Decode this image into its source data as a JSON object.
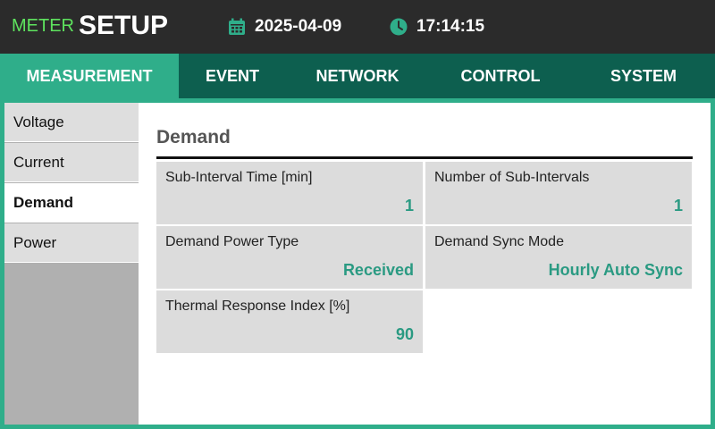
{
  "header": {
    "brand_primary": "METER",
    "brand_secondary": "SETUP",
    "date": "2025-04-09",
    "time": "17:14:15",
    "date_icon": "calendar-icon",
    "time_icon": "clock-icon"
  },
  "tabs": [
    {
      "label": "MEASUREMENT",
      "active": true
    },
    {
      "label": "EVENT",
      "active": false
    },
    {
      "label": "NETWORK",
      "active": false
    },
    {
      "label": "CONTROL",
      "active": false
    },
    {
      "label": "SYSTEM",
      "active": false
    }
  ],
  "sidebar": {
    "items": [
      {
        "label": "Voltage",
        "active": false
      },
      {
        "label": "Current",
        "active": false
      },
      {
        "label": "Demand",
        "active": true
      },
      {
        "label": "Power",
        "active": false
      }
    ]
  },
  "main": {
    "title": "Demand",
    "fields": [
      {
        "label": "Sub-Interval Time [min]",
        "value": "1"
      },
      {
        "label": "Number of Sub-Intervals",
        "value": "1"
      },
      {
        "label": "Demand Power Type",
        "value": "Received"
      },
      {
        "label": "Demand Sync Mode",
        "value": "Hourly Auto Sync"
      },
      {
        "label": "Thermal Response Index [%]",
        "value": "90"
      }
    ]
  },
  "colors": {
    "accent": "#2fae8a",
    "tab_bar": "#0d5f4f",
    "value_text": "#2a9a82",
    "brand_green": "#5ee35e",
    "header_bg": "#2b2b2b"
  }
}
